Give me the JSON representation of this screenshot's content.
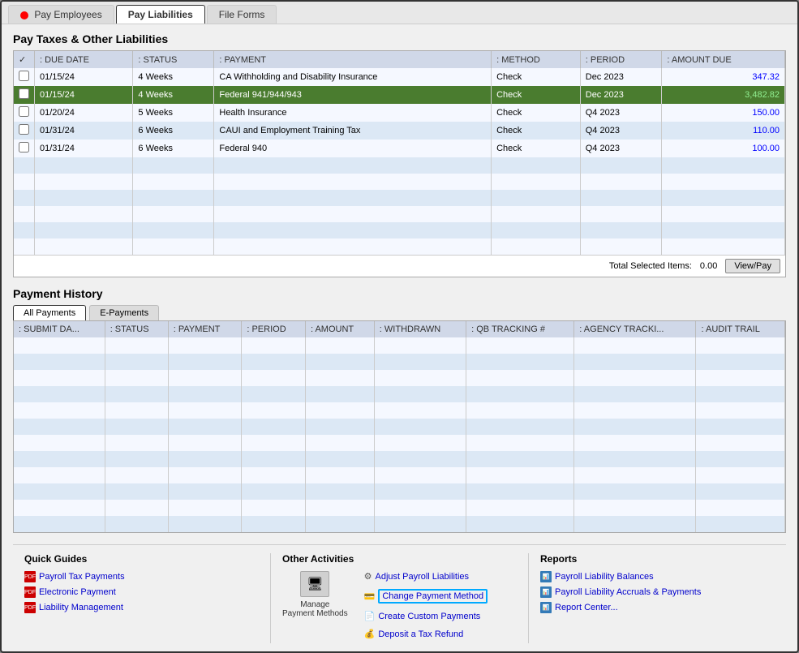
{
  "tabs": [
    {
      "id": "pay-employees",
      "label": "Pay Employees",
      "active": false,
      "hasAlert": true
    },
    {
      "id": "pay-liabilities",
      "label": "Pay Liabilities",
      "active": true,
      "hasAlert": false
    },
    {
      "id": "file-forms",
      "label": "File Forms",
      "active": false,
      "hasAlert": false
    }
  ],
  "main_section_title": "Pay Taxes & Other Liabilities",
  "table": {
    "columns": [
      "",
      "DUE DATE",
      "STATUS",
      "PAYMENT",
      "METHOD",
      "PERIOD",
      "AMOUNT DUE"
    ],
    "rows": [
      {
        "check": false,
        "due_date": "01/15/24",
        "status": "4 Weeks",
        "payment": "CA Withholding and Disability Insurance",
        "method": "Check",
        "period": "Dec 2023",
        "amount": "347.32",
        "selected": false
      },
      {
        "check": false,
        "due_date": "01/15/24",
        "status": "4 Weeks",
        "payment": "Federal 941/944/943",
        "method": "Check",
        "period": "Dec 2023",
        "amount": "3,482.82",
        "selected": true
      },
      {
        "check": false,
        "due_date": "01/20/24",
        "status": "5 Weeks",
        "payment": "Health Insurance",
        "method": "Check",
        "period": "Q4 2023",
        "amount": "150.00",
        "selected": false
      },
      {
        "check": false,
        "due_date": "01/31/24",
        "status": "6 Weeks",
        "payment": "CAUI and Employment Training Tax",
        "method": "Check",
        "period": "Q4 2023",
        "amount": "110.00",
        "selected": false
      },
      {
        "check": false,
        "due_date": "01/31/24",
        "status": "6 Weeks",
        "payment": "Federal 940",
        "method": "Check",
        "period": "Q4 2023",
        "amount": "100.00",
        "selected": false
      }
    ],
    "empty_rows": 6,
    "total_label": "Total Selected Items:",
    "total_value": "0.00",
    "view_pay_btn": "View/Pay"
  },
  "payment_history": {
    "title": "Payment History",
    "tabs": [
      {
        "id": "all-payments",
        "label": "All Payments",
        "active": true
      },
      {
        "id": "e-payments",
        "label": "E-Payments",
        "active": false
      }
    ],
    "columns": [
      "SUBMIT DA...",
      "STATUS",
      "PAYMENT",
      "PERIOD",
      "AMOUNT",
      "WITHDRAWN",
      "QB TRACKING #",
      "AGENCY TRACKI...",
      "AUDIT TRAIL"
    ],
    "empty_rows": 12
  },
  "quick_guides": {
    "title": "Quick Guides",
    "links": [
      {
        "label": "Payroll Tax Payments",
        "icon": "pdf"
      },
      {
        "label": "Electronic Payment",
        "icon": "pdf"
      },
      {
        "label": "Liability Management",
        "icon": "pdf"
      }
    ]
  },
  "other_activities": {
    "title": "Other Activities",
    "manage_icon": "🖥",
    "manage_label": "Manage\nPayment Methods",
    "links": [
      {
        "label": "Adjust Payroll Liabilities",
        "icon": "adjust",
        "highlighted": false
      },
      {
        "label": "Change Payment Method",
        "icon": "change",
        "highlighted": true
      },
      {
        "label": "Create Custom Payments",
        "icon": "create",
        "highlighted": false
      },
      {
        "label": "Deposit a Tax Refund",
        "icon": "deposit",
        "highlighted": false
      }
    ]
  },
  "reports": {
    "title": "Reports",
    "links": [
      {
        "label": "Payroll Liability Balances",
        "icon": "img"
      },
      {
        "label": "Payroll Liability Accruals & Payments",
        "icon": "img"
      },
      {
        "label": "Report Center...",
        "icon": "img"
      }
    ]
  }
}
